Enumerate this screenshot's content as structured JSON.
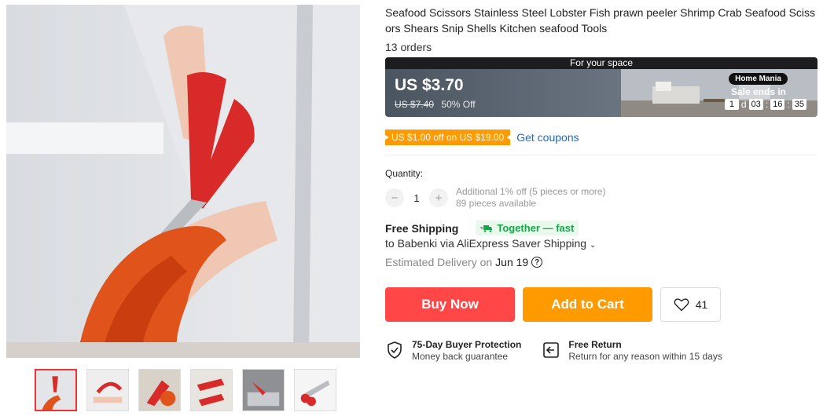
{
  "product": {
    "title": "Seafood Scissors Stainless Steel Lobster Fish prawn peeler Shrimp Crab Seafood Scissors Shears Snip Shells Kitchen seafood Tools",
    "orders": "13 orders"
  },
  "price_banner": {
    "top_label": "For your space",
    "price": "US $3.70",
    "original_price": "US $7.40",
    "discount": "50% Off",
    "store_badge": "Home Mania",
    "sale_label": "Sale ends in",
    "countdown": {
      "days": "1",
      "days_unit": "d",
      "hours": "03",
      "minutes": "16",
      "seconds": "35"
    }
  },
  "coupon": {
    "text": "US $1.00 off on US $19.00",
    "link": "Get coupons"
  },
  "quantity": {
    "label": "Quantity:",
    "value": "1",
    "minus": "−",
    "plus": "+",
    "note": "Additional 1% off (5 pieces or more)",
    "available": "89 pieces available"
  },
  "shipping": {
    "title": "Free Shipping",
    "badge": "Together — fast",
    "to": "to Babenki via AliExpress Saver Shipping",
    "delivery_label": "Estimated Delivery on",
    "delivery_date": "Jun 19",
    "help": "?"
  },
  "actions": {
    "buy_now": "Buy Now",
    "add_to_cart": "Add to Cart",
    "wishlist_count": "41"
  },
  "guarantees": [
    {
      "title": "75-Day Buyer Protection",
      "subtitle": "Money back guarantee",
      "icon": "shield-check-icon"
    },
    {
      "title": "Free Return",
      "subtitle": "Return for any reason within 15 days",
      "icon": "return-icon"
    }
  ],
  "colors": {
    "buy": "#ff4747",
    "cart": "#ff9a00",
    "coupon": "#ff9a00",
    "link": "#1a6bd1",
    "shipping_badge": "#12a84a"
  }
}
